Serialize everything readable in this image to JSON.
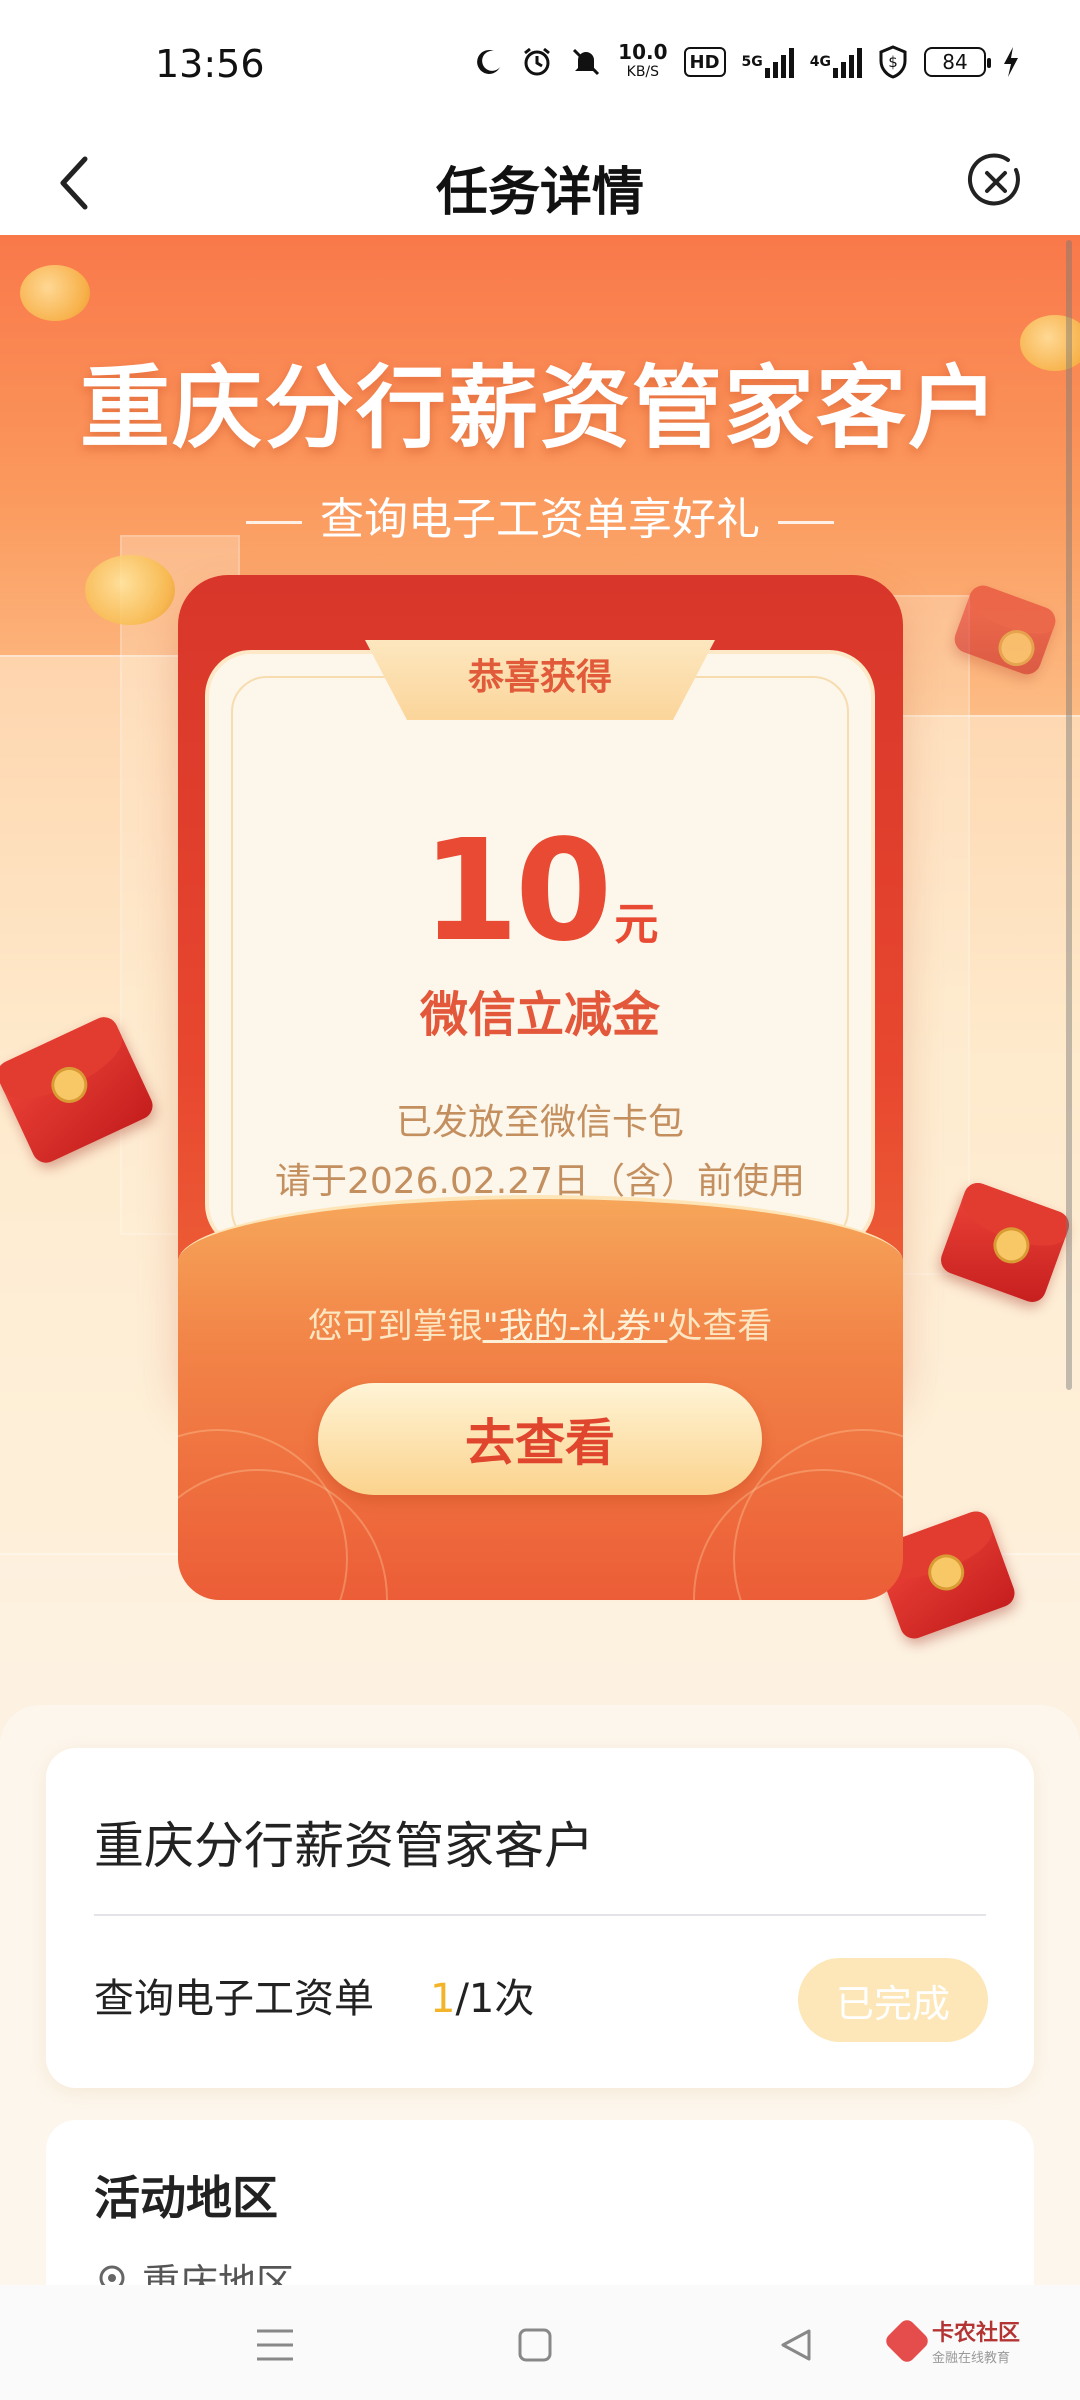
{
  "status_bar": {
    "time": "13:56",
    "net_speed": "10.0",
    "net_speed_unit": "KB/S",
    "hd": "HD",
    "sim1": "5G",
    "sim2": "4G",
    "battery": "84"
  },
  "nav": {
    "title": "任务详情"
  },
  "banner": {
    "title": "重庆分行薪资管家客户",
    "subtitle": "查询电子工资单享好礼"
  },
  "prize": {
    "tab_label": "恭喜获得",
    "amount": "10",
    "unit": "元",
    "name": "微信立减金",
    "desc": "已发放至微信卡包",
    "expiry": "请于2026.02.27日（含）前使用",
    "hint_prefix": "您可到掌银",
    "hint_link": "\"我的-礼券\"",
    "hint_suffix": "处查看",
    "button_label": "去查看"
  },
  "task": {
    "title": "重庆分行薪资管家客户",
    "item_label": "查询电子工资单",
    "progress_done": "1",
    "progress_total": "/1次",
    "status": "已完成"
  },
  "region": {
    "title": "活动地区",
    "item": "重庆地区"
  },
  "watermark": {
    "main": "卡农社区",
    "sub": "金融在线教育"
  },
  "colors": {
    "accent": "#e84a33",
    "gold": "#f3b42a",
    "banner_top": "#f9784a"
  }
}
